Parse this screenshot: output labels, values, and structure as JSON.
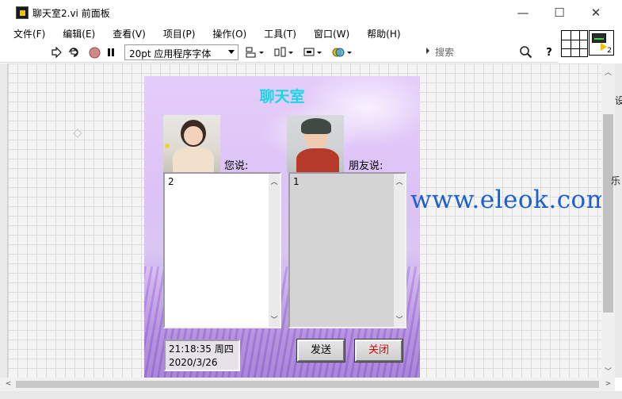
{
  "window": {
    "title": "聊天室2.vi 前面板",
    "minimize": "—",
    "maximize": "☐",
    "close": "✕"
  },
  "menu": [
    "文件(F)",
    "编辑(E)",
    "查看(V)",
    "项目(P)",
    "操作(O)",
    "工具(T)",
    "窗口(W)",
    "帮助(H)"
  ],
  "toolbar": {
    "font": "20pt 应用程序字体",
    "search_placeholder": "搜索",
    "help": "?"
  },
  "icon_panel": {
    "number": "2"
  },
  "panel": {
    "title": "聊天室",
    "my_label": "您说:",
    "friend_label": "朋友说:",
    "my_message": "2",
    "friend_message": "1",
    "time": "21:18:35  周四",
    "date": "2020/3/26",
    "send_button": "发送",
    "close_button": "关闭"
  },
  "watermark": "www.eleok.com",
  "right_clip": {
    "a": "设",
    "b": "乐"
  },
  "colors": {
    "title_cyan": "#1ad7e6",
    "close_red": "#e00000",
    "watermark_blue": "#1d5fcf"
  }
}
